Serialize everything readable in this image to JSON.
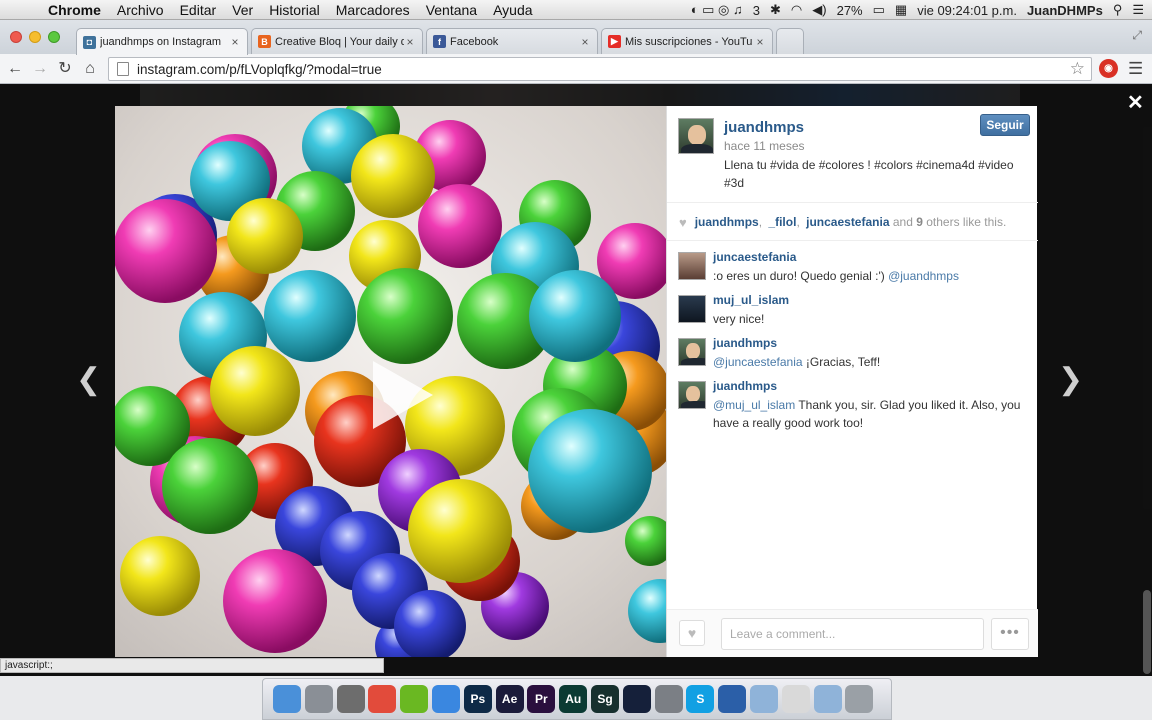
{
  "menubar": {
    "app_name": "Chrome",
    "menus": [
      "Archivo",
      "Editar",
      "Ver",
      "Historial",
      "Marcadores",
      "Ventana",
      "Ayuda"
    ],
    "battery": "27%",
    "clock": "vie 09:24:01 p.m.",
    "user": "JuanDHMPs",
    "tray_count": "3"
  },
  "tabs": [
    {
      "label": "juandhmps on Instagram",
      "favicon": "instagram-icon",
      "color": "#3f729b"
    },
    {
      "label": "Creative Bloq | Your daily d",
      "favicon": "creativebloq-icon",
      "color": "#e8641e"
    },
    {
      "label": "Facebook",
      "favicon": "facebook-icon",
      "color": "#3b5998"
    },
    {
      "label": "Mis suscripciones - YouTu",
      "favicon": "youtube-icon",
      "color": "#e52d27"
    }
  ],
  "address_bar": {
    "url": "instagram.com/p/fLVoplqfkg/?modal=true"
  },
  "post": {
    "username": "juandhmps",
    "time_ago": "hace 11 meses",
    "caption": "Llena tu #vida de #colores ! #colors #cinema4d #video #3d",
    "follow_label": "Seguir",
    "likes": {
      "users": [
        "juandhmps",
        "_filol",
        "juncaestefania"
      ],
      "and_text": "and",
      "others_count": "9",
      "suffix": "others like this."
    }
  },
  "comments": [
    {
      "user": "juncaestefania",
      "text": ":o eres un duro! Quedo genial :')",
      "mention": "@juandhmps",
      "mention_first": false
    },
    {
      "user": "muj_ul_islam",
      "text": "very nice!",
      "mention": "",
      "mention_first": false
    },
    {
      "user": "juandhmps",
      "text": "¡Gracias, Teff!",
      "mention": "@juncaestefania",
      "mention_first": true
    },
    {
      "user": "juandhmps",
      "text": "Thank you, sir. Glad you liked it. Also, you have a really good work too!",
      "mention": "@muj_ul_islam",
      "mention_first": true
    }
  ],
  "comment_input": {
    "placeholder": "Leave a comment..."
  },
  "more_label": "•••",
  "statusbar": {
    "text": "javascript:;"
  },
  "dock": [
    {
      "name": "finder-icon",
      "color": "#4a90d9",
      "label": ""
    },
    {
      "name": "launchpad-icon",
      "color": "#8a8f96",
      "label": ""
    },
    {
      "name": "photo-icon",
      "color": "#6d6d6d",
      "label": ""
    },
    {
      "name": "chrome-icon",
      "color": "#e24b3b",
      "label": ""
    },
    {
      "name": "spotify-icon",
      "color": "#6ab822",
      "label": ""
    },
    {
      "name": "itunes-icon",
      "color": "#3a87e0",
      "label": ""
    },
    {
      "name": "photoshop-icon",
      "color": "#0e2a47",
      "label": "Ps"
    },
    {
      "name": "after-effects-icon",
      "color": "#1b1b3a",
      "label": "Ae"
    },
    {
      "name": "premiere-icon",
      "color": "#2a0f3e",
      "label": "Pr"
    },
    {
      "name": "audition-icon",
      "color": "#0b3a33",
      "label": "Au"
    },
    {
      "name": "speedgrade-icon",
      "color": "#17302e",
      "label": "Sg"
    },
    {
      "name": "cinema4d-icon",
      "color": "#15203a",
      "label": ""
    },
    {
      "name": "system-preferences-icon",
      "color": "#7b7f85",
      "label": ""
    },
    {
      "name": "skype-icon",
      "color": "#11a0e3",
      "label": "S"
    },
    {
      "name": "quicktime-icon",
      "color": "#2b5fa8",
      "label": ""
    },
    {
      "name": "folder-icon",
      "color": "#8fb3d9",
      "label": ""
    },
    {
      "name": "document-icon",
      "color": "#d9d9d9",
      "label": ""
    },
    {
      "name": "downloads-icon",
      "color": "#8fb3d9",
      "label": ""
    },
    {
      "name": "trash-icon",
      "color": "#9aa0a6",
      "label": ""
    }
  ]
}
